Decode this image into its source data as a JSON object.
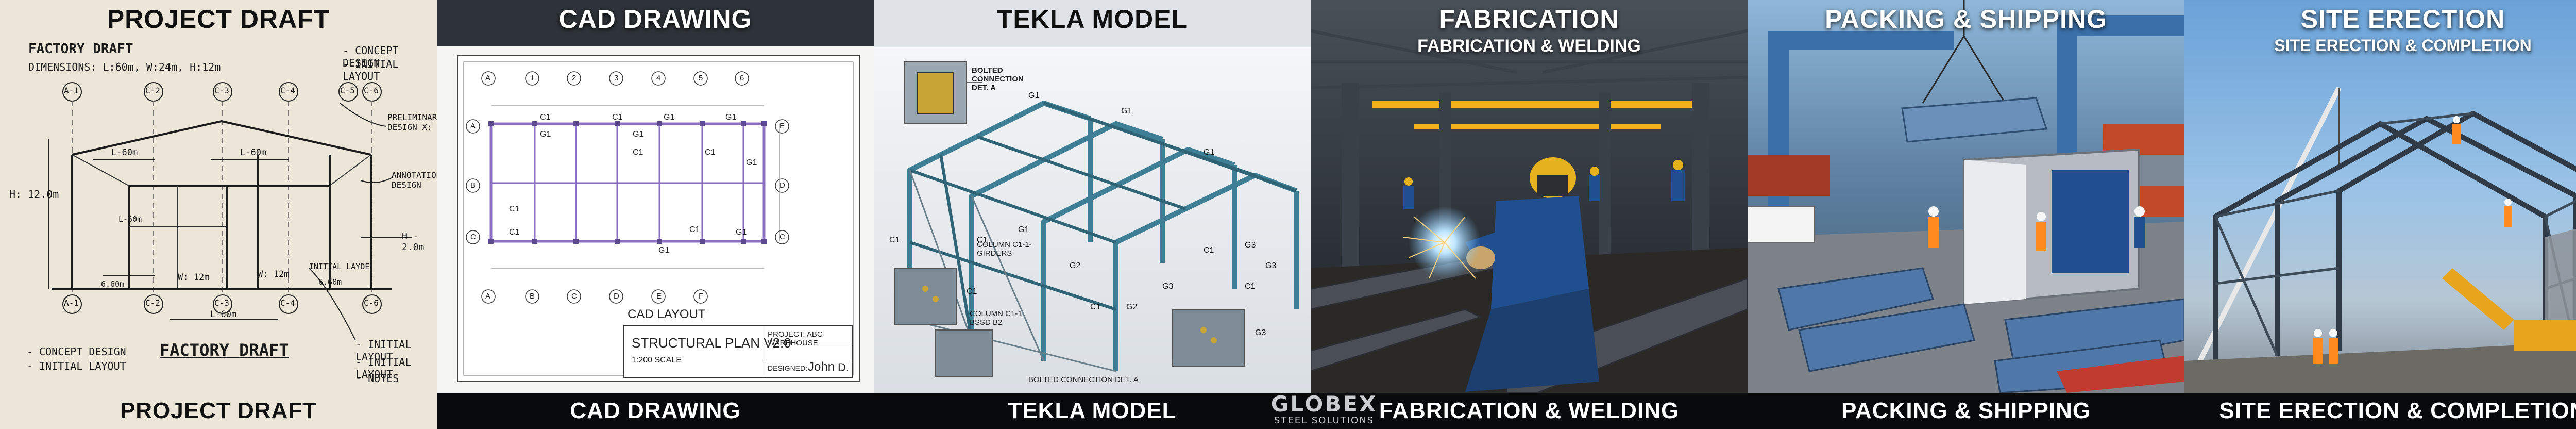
{
  "panels": {
    "draft": {
      "title": "PROJECT DRAFT",
      "caption": "PROJECT DRAFT",
      "sketch_title": "FACTORY DRAFT",
      "dimensions": "DIMENSIONS: L:60m, W:24m, H:12m",
      "notes_top": [
        "- CONCEPT DESIGN",
        "- INITIAL LAYOUT"
      ],
      "prelim": "PRELIMINARY DESIGN X:",
      "annotations": "ANNOTATIONS DESIGN",
      "height_label": "H: 12.0m",
      "h2": "H - 2.0m",
      "w12": "W: 12m",
      "w12b": "W: 12m",
      "l60": "L-60m",
      "l60b": "L-60m",
      "l60c": "L-60m",
      "l60d": "L-60m",
      "six": "6.60m",
      "six2": "6.60m",
      "initial_layde": "INITIAL LAYDE",
      "grid_top": [
        "A-1",
        "C-2",
        "C-3",
        "C-4",
        "C-5",
        "C-6"
      ],
      "grid_bottom": [
        "A-1",
        "C-2",
        "C-3",
        "C-4",
        "C-6"
      ],
      "notes_bl": [
        "- CONCEPT DESIGN",
        "- INITIAL LAYOUT"
      ],
      "sketch_title2": "FACTORY DRAFT",
      "notes_br": [
        "- INITIAL LAYOUT",
        "- INITIAL LAYOUT",
        "- NOTES"
      ]
    },
    "cad": {
      "title": "CAD DRAWING",
      "caption": "CAD DRAWING",
      "grid_top": [
        "A",
        "1",
        "2",
        "3",
        "4",
        "5",
        "6"
      ],
      "grid_bottom": [
        "A",
        "B",
        "C",
        "D",
        "E",
        "F"
      ],
      "rows_left": [
        "A",
        "B",
        "C"
      ],
      "rows_right": [
        "E",
        "D",
        "C"
      ],
      "layout_label": "CAD LAYOUT",
      "plan_title": "STRUCTURAL PLAN V2.0",
      "scale": "1:200 SCALE",
      "project": "PROJECT: ABC WAREHOUSE",
      "designed": "DESIGNED:",
      "designer": "John",
      "check": "D."
    },
    "tekla": {
      "title": "TEKLA MODEL",
      "caption": "TEKLA MODEL",
      "callout_bolted": "BOLTED CONNECTION DET. A",
      "callout_column": "COLUMN C1-1-GIRDERS",
      "callout_column2": "COLUMN C1-1: BSSD B2",
      "callout_bottom": "BOLTED CONNECTION DET. A",
      "labels": [
        "G1",
        "G2",
        "G3",
        "C1",
        "C1-1",
        "C1",
        "C1",
        "G3"
      ]
    },
    "fab": {
      "title": "FABRICATION",
      "subtitle": "FABRICATION & WELDING",
      "caption": "FABRICATION & WELDING"
    },
    "pack": {
      "title": "PACKING & SHIPPING",
      "caption": "PACKING & SHIPPING"
    },
    "site": {
      "title": "SITE ERECTION",
      "subtitle": "SITE ERECTION & COMPLETION",
      "caption": "SITE ERECTION & COMPLETION"
    }
  },
  "logo": {
    "main": "GLOBEX",
    "sub": "STEEL SOLUTIONS"
  },
  "colors": {
    "caption_bg": "#080a0c",
    "tekla_steel": "#3f7f96",
    "cad_purple": "#8a6fc2",
    "weld_spark": "#7fc8ff",
    "container_blue": "#1f4f8e"
  }
}
